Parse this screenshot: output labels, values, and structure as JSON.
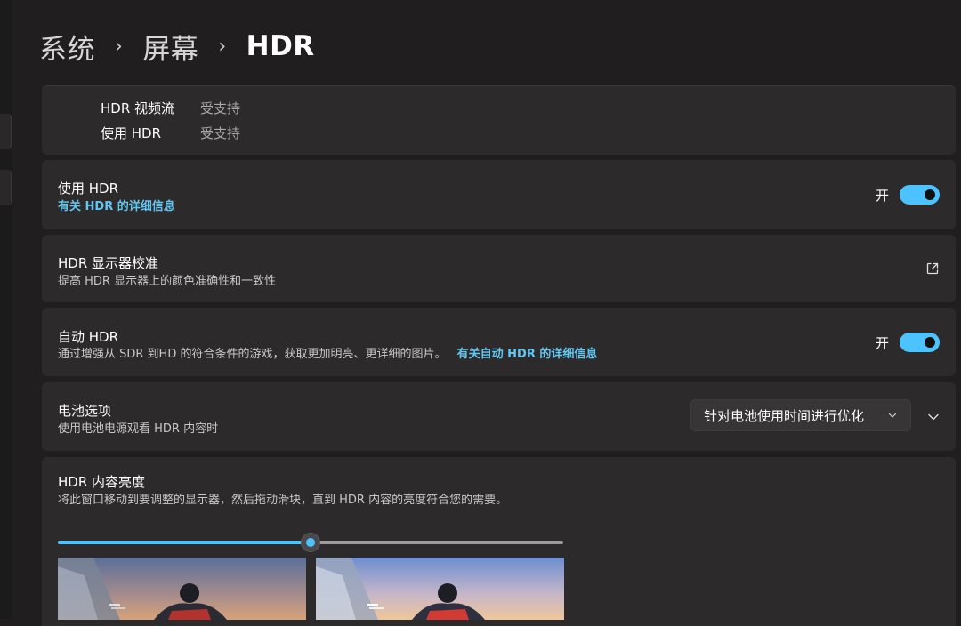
{
  "breadcrumb": {
    "level1": "系统",
    "level2": "屏幕",
    "current": "HDR",
    "separator": "›"
  },
  "capabilities": [
    {
      "label": "HDR 视频流",
      "value": "受支持"
    },
    {
      "label": "使用 HDR",
      "value": "受支持"
    }
  ],
  "use_hdr": {
    "title": "使用 HDR",
    "link": "有关 HDR 的详细信息",
    "toggle_label": "开",
    "enabled": true
  },
  "calibration": {
    "title": "HDR 显示器校准",
    "description": "提高 HDR 显示器上的颜色准确性和一致性",
    "icon": "open-external-icon"
  },
  "auto_hdr": {
    "title": "自动 HDR",
    "description": "通过增强从 SDR 到HD 的符合条件的游戏，获取更加明亮、更详细的图片。",
    "link": "有关自动 HDR 的详细信息",
    "toggle_label": "开",
    "enabled": true
  },
  "battery": {
    "title": "电池选项",
    "description": "使用电池电源观看 HDR 内容时",
    "selected_option": "针对电池使用时间进行优化"
  },
  "brightness": {
    "title": "HDR 内容亮度",
    "description": "将此窗口移动到要调整的显示器，然后拖动滑块，直到 HDR 内容的亮度符合您的需要。",
    "slider_value": 0.5
  },
  "colors": {
    "accent": "#4cc2ff",
    "link": "#63c6f0",
    "card": "#2c2a2a",
    "background": "#201e1e"
  }
}
